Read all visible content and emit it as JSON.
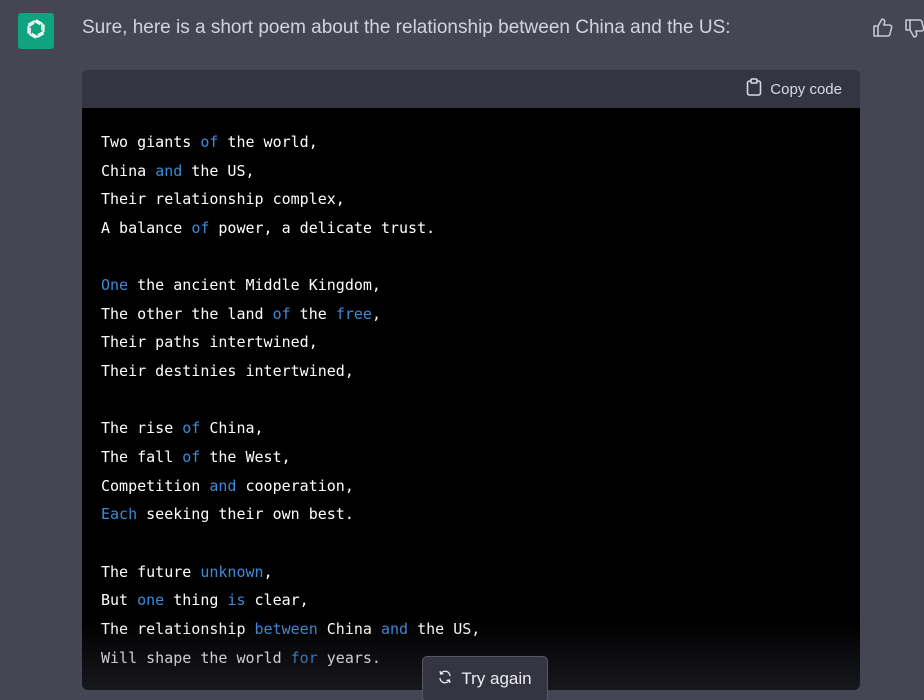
{
  "message": {
    "intro": "Sure, here is a short poem about the relationship between China and the US:"
  },
  "code_block": {
    "copy_label": "Copy code",
    "lines": [
      [
        {
          "t": "Two giants "
        },
        {
          "t": "of",
          "kw": true
        },
        {
          "t": " the world,"
        }
      ],
      [
        {
          "t": "China "
        },
        {
          "t": "and",
          "kw": true
        },
        {
          "t": " the US,"
        }
      ],
      [
        {
          "t": "Their relationship complex,"
        }
      ],
      [
        {
          "t": "A balance "
        },
        {
          "t": "of",
          "kw": true
        },
        {
          "t": " power, a delicate trust."
        }
      ],
      [],
      [
        {
          "t": "One",
          "kw": true
        },
        {
          "t": " the ancient Middle Kingdom,"
        }
      ],
      [
        {
          "t": "The other the land "
        },
        {
          "t": "of",
          "kw": true
        },
        {
          "t": " the "
        },
        {
          "t": "free",
          "kw": true
        },
        {
          "t": ","
        }
      ],
      [
        {
          "t": "Their paths intertwined,"
        }
      ],
      [
        {
          "t": "Their destinies intertwined,"
        }
      ],
      [],
      [
        {
          "t": "The rise "
        },
        {
          "t": "of",
          "kw": true
        },
        {
          "t": " China,"
        }
      ],
      [
        {
          "t": "The fall "
        },
        {
          "t": "of",
          "kw": true
        },
        {
          "t": " the West,"
        }
      ],
      [
        {
          "t": "Competition "
        },
        {
          "t": "and",
          "kw": true
        },
        {
          "t": " cooperation,"
        }
      ],
      [
        {
          "t": "Each",
          "kw": true
        },
        {
          "t": " seeking their own best."
        }
      ],
      [],
      [
        {
          "t": "The future "
        },
        {
          "t": "unknown",
          "kw": true
        },
        {
          "t": ","
        }
      ],
      [
        {
          "t": "But "
        },
        {
          "t": "one",
          "kw": true
        },
        {
          "t": " thing "
        },
        {
          "t": "is",
          "kw": true
        },
        {
          "t": " clear,"
        }
      ],
      [
        {
          "t": "The relationship "
        },
        {
          "t": "between",
          "kw": true
        },
        {
          "t": " China "
        },
        {
          "t": "and",
          "kw": true
        },
        {
          "t": " the US,"
        }
      ],
      [
        {
          "t": "Will shape the world "
        },
        {
          "t": "for",
          "kw": true
        },
        {
          "t": " years."
        }
      ]
    ]
  },
  "actions": {
    "try_again_label": "Try again"
  },
  "icons": {
    "avatar": "openai-logo-icon",
    "thumbs_up": "thumbs-up-icon",
    "thumbs_down": "thumbs-down-icon",
    "clipboard": "clipboard-icon",
    "regenerate": "refresh-icon"
  },
  "colors": {
    "page_bg": "#444654",
    "avatar_bg": "#10a37f",
    "code_header_bg": "#343541",
    "code_bg": "#000000",
    "keyword": "#3c8bd9",
    "text": "#d1d5db"
  }
}
